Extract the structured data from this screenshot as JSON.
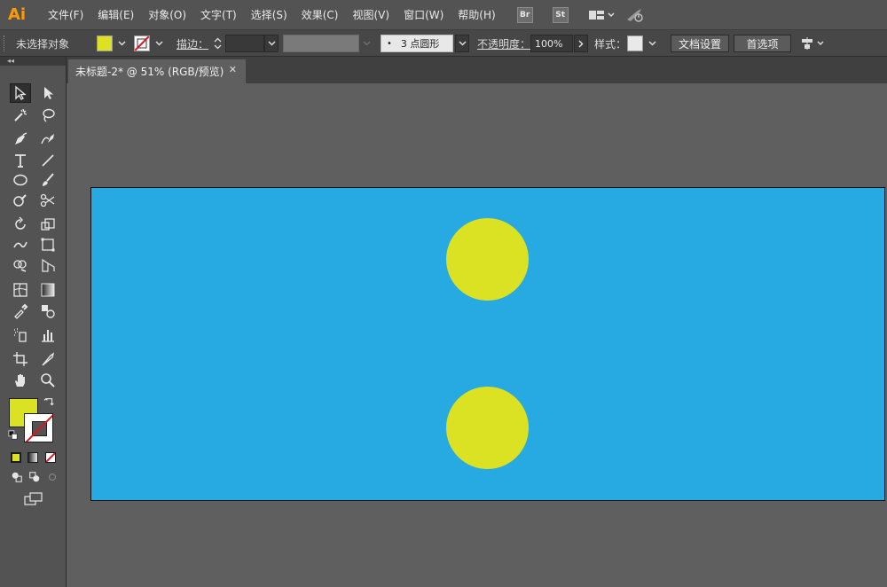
{
  "app": {
    "logo": "Ai"
  },
  "menu": {
    "items": [
      "文件(F)",
      "编辑(E)",
      "对象(O)",
      "文字(T)",
      "选择(S)",
      "效果(C)",
      "视图(V)",
      "窗口(W)",
      "帮助(H)"
    ],
    "bridge_label": "Br",
    "stock_label": "St"
  },
  "control_bar": {
    "selection_status": "未选择对象",
    "fill_color": "#dbe123",
    "stroke_label": "描边：",
    "brush_label": "3 点圆形",
    "opacity_label": "不透明度：",
    "opacity_value": "100%",
    "style_label": "样式：",
    "document_setup_button": "文档设置",
    "preferences_button": "首选项"
  },
  "document": {
    "tab_title": "未标题-2* @ 51% (RGB/预览)",
    "artboard_color": "#27aae1",
    "shape_color": "#dbe123",
    "shapes": [
      {
        "type": "circle",
        "label": "yellow circle"
      },
      {
        "type": "circle",
        "label": "yellow circle"
      }
    ]
  },
  "tools": {
    "fill_color": "#dbe123",
    "stroke_color": "none"
  }
}
